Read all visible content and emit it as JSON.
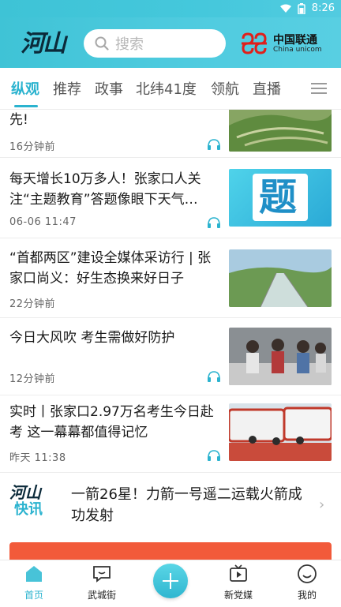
{
  "status": {
    "time": "8:26"
  },
  "header": {
    "logo_text": "河山",
    "search_placeholder": "搜索",
    "sponsor_cn": "中国联通",
    "sponsor_en": "China unicom"
  },
  "tabs": [
    {
      "label": "纵观",
      "active": true
    },
    {
      "label": "推荐",
      "active": false
    },
    {
      "label": "政事",
      "active": false
    },
    {
      "label": "北纬41度",
      "active": false
    },
    {
      "label": "领航",
      "active": false
    },
    {
      "label": "直播",
      "active": false
    }
  ],
  "news": [
    {
      "title": "先!",
      "meta": "16分钟前",
      "thumb": "terraces"
    },
    {
      "title": "每天增长10万多人！张家口人关注“主题教育”答题像眼下天气…",
      "meta": "06-06  11:47",
      "thumb": "quiz-graphic",
      "thumb_text": "题"
    },
    {
      "title": "“首都两区”建设全媒体采访行 | 张家口尚义：好生态换来好日子",
      "meta": "22分钟前",
      "thumb": "glass-bridge"
    },
    {
      "title": "今日大风吹  考生需做好防护",
      "meta": "12分钟前",
      "thumb": "students-masks"
    },
    {
      "title": "实时丨张家口2.97万名考生今日赴考    这一幕幕都值得记忆",
      "meta": "昨天  11:38",
      "thumb": "buses"
    }
  ],
  "flash": {
    "logo_top": "河山",
    "logo_bottom": "快讯",
    "title": "一箭26星！力箭一号遥二运载火箭成功发射"
  },
  "bottom_nav": [
    {
      "label": "首页",
      "active": true
    },
    {
      "label": "武城街",
      "active": false
    },
    {
      "label": "",
      "active": false
    },
    {
      "label": "新党媒",
      "active": false
    },
    {
      "label": "我的",
      "active": false
    }
  ],
  "colors": {
    "accent": "#2bb3cf",
    "header": "#45c8dc",
    "banner": "#f25a3a"
  }
}
